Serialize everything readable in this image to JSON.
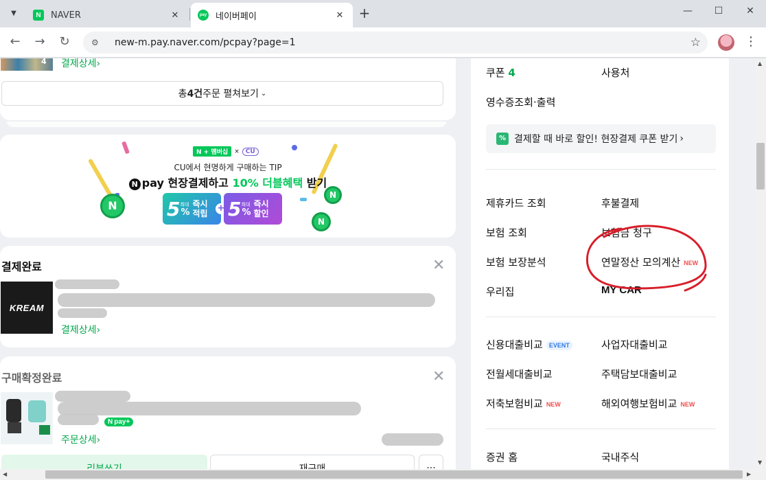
{
  "browser": {
    "tabs": [
      {
        "title": "NAVER",
        "favicon": "N",
        "active": false
      },
      {
        "title": "네이버페이",
        "favicon": "pay",
        "active": true
      }
    ],
    "url": "new-m.pay.naver.com/pcpay?page=1"
  },
  "orders_top": {
    "partial_detail_link": "결제상세",
    "partial_count_badge": "4",
    "expand_pre": "총 ",
    "expand_count": "4건",
    "expand_post": " 주문 펼쳐보기"
  },
  "banner": {
    "badge_naver": "N + 멤버십",
    "badge_x": "×",
    "badge_cu": "CU",
    "line1": "CU에서 현명하게 구매하는 TIP",
    "line2_pre": "pay 현장결제하고 ",
    "line2_highlight": "10% 더블혜택",
    "line2_post": " 받기",
    "tile_a": {
      "small_top": "최대",
      "big": "5",
      "pct": "%",
      "l1": "즉시",
      "l2": "적립"
    },
    "tile_b": {
      "small_top": "최대",
      "big": "5",
      "pct": "%",
      "l1": "즉시",
      "l2": "할인"
    }
  },
  "order_complete": {
    "title": "결제완료",
    "merchant_logo": "KREAM",
    "detail_link": "결제상세"
  },
  "order_confirmed": {
    "title": "구매확정완료",
    "pay_badge": "pay",
    "detail_link": "주문상세",
    "buttons": {
      "review": "리뷰쓰기",
      "rebuy": "재구매",
      "more": "···"
    }
  },
  "right_panel": {
    "coupon_label": "쿠폰",
    "coupon_count": "4",
    "usage": "사용처",
    "receipt": "영수증조회·출력",
    "promo": "결제할 때 바로 할인! 현장결제 쿠폰 받기",
    "group1": [
      {
        "label": "제휴카드 조회"
      },
      {
        "label": "후불결제"
      },
      {
        "label": "보험 조회"
      },
      {
        "label": "보험금 청구"
      },
      {
        "label": "보험 보장분석"
      },
      {
        "label": "연말정산 모의계산",
        "tag": "NEW"
      },
      {
        "label": "우리집"
      },
      {
        "label": "MY CAR"
      }
    ],
    "group2": [
      {
        "label": "신용대출비교",
        "tag": "EVENT"
      },
      {
        "label": "사업자대출비교"
      },
      {
        "label": "전월세대출비교"
      },
      {
        "label": "주택담보대출비교"
      },
      {
        "label": "저축보험비교",
        "tag": "NEW"
      },
      {
        "label": "해외여행보험비교",
        "tag": "NEW"
      }
    ],
    "group3": [
      {
        "label": "증권 홈"
      },
      {
        "label": "국내주식"
      }
    ]
  },
  "colors": {
    "accent": "#03c75a",
    "link_green": "#03a94d",
    "new_tag": "#f24e4e",
    "annotation_circle": "#d81e2b"
  }
}
